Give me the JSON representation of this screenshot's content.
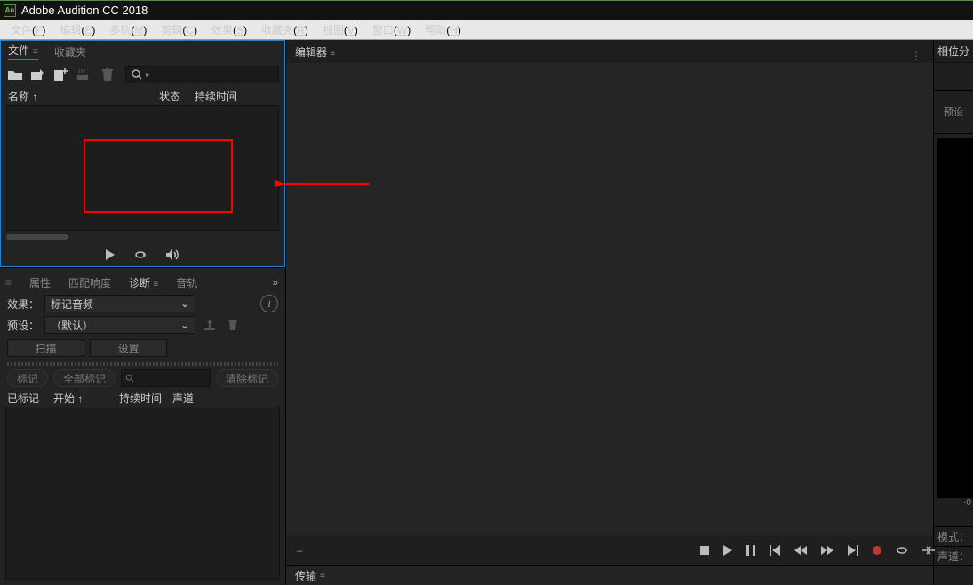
{
  "app": {
    "title": "Adobe Audition CC 2018",
    "logo": "Au"
  },
  "menu": {
    "file": "文件",
    "file_k": "F",
    "edit": "编辑",
    "edit_k": "E",
    "multitrack": "多轨",
    "multitrack_k": "M",
    "clip": "剪辑",
    "clip_k": "C",
    "effects": "效果",
    "effects_k": "S",
    "favorites": "收藏夹",
    "favorites_k": "R",
    "view": "视图",
    "view_k": "V",
    "window": "窗口",
    "window_k": "W",
    "help": "帮助",
    "help_k": "H"
  },
  "files_panel": {
    "tab_files": "文件",
    "tab_favorites": "收藏夹",
    "col_name": "名称",
    "col_status": "状态",
    "col_duration": "持续时间",
    "sort_arrow": "↑"
  },
  "diag_panel": {
    "tab_props": "属性",
    "tab_match": "匹配响度",
    "tab_diag": "诊断",
    "tab_audio": "音轨",
    "label_effect": "效果：",
    "effect_val": "标记音频",
    "label_preset": "预设：",
    "preset_val": "（默认）",
    "btn_scan": "扫描",
    "btn_settings": "设置",
    "btn_mark": "标记",
    "btn_markall": "全部标记",
    "btn_clear": "清除标记",
    "col_marked": "已标记",
    "col_start": "开始",
    "col_duration": "持续时间",
    "col_channel": "声道",
    "start_arrow": "↑"
  },
  "editor": {
    "title": "编辑器",
    "dash": "–"
  },
  "transport_panel": {
    "label": "传输"
  },
  "right": {
    "title": "相位分",
    "preset": "预设",
    "scale": "-0",
    "mode": "模式：",
    "channel": "声道："
  }
}
